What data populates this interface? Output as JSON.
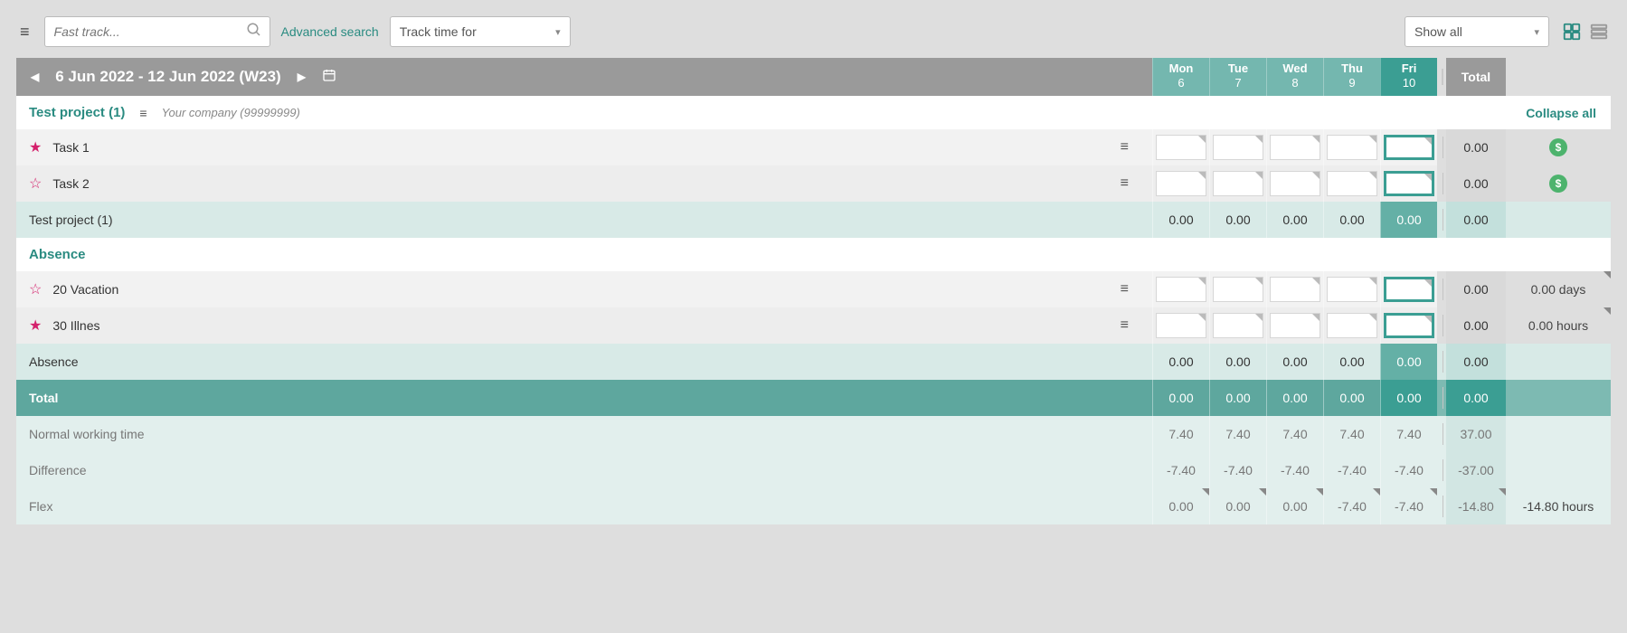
{
  "topbar": {
    "search_placeholder": "Fast track...",
    "advanced_search": "Advanced search",
    "track_time_for": "Track time for",
    "show_all": "Show all"
  },
  "header": {
    "date_range": "6 Jun 2022 - 12 Jun 2022 (W23)",
    "days": [
      {
        "name": "Mon",
        "num": "6"
      },
      {
        "name": "Tue",
        "num": "7"
      },
      {
        "name": "Wed",
        "num": "8"
      },
      {
        "name": "Thu",
        "num": "9"
      },
      {
        "name": "Fri",
        "num": "10"
      }
    ],
    "total": "Total"
  },
  "section1": {
    "title": "Test project (1)",
    "sub": "Your company (99999999)",
    "collapse": "Collapse all"
  },
  "rows": {
    "task1": {
      "label": "Task 1",
      "total": "0.00"
    },
    "task2": {
      "label": "Task 2",
      "total": "0.00"
    },
    "proj_sub": {
      "label": "Test project (1)",
      "v": [
        "0.00",
        "0.00",
        "0.00",
        "0.00",
        "0.00"
      ],
      "total": "0.00"
    }
  },
  "section2": {
    "title": "Absence"
  },
  "absence": {
    "vacation": {
      "label": "20 Vacation",
      "total": "0.00",
      "unit": "0.00 days"
    },
    "illness": {
      "label": "30 Illnes",
      "total": "0.00",
      "unit": "0.00 hours"
    },
    "sub": {
      "label": "Absence",
      "v": [
        "0.00",
        "0.00",
        "0.00",
        "0.00",
        "0.00"
      ],
      "total": "0.00"
    }
  },
  "total_row": {
    "label": "Total",
    "v": [
      "0.00",
      "0.00",
      "0.00",
      "0.00",
      "0.00"
    ],
    "total": "0.00"
  },
  "normal": {
    "label": "Normal working time",
    "v": [
      "7.40",
      "7.40",
      "7.40",
      "7.40",
      "7.40"
    ],
    "total": "37.00"
  },
  "diff": {
    "label": "Difference",
    "v": [
      "-7.40",
      "-7.40",
      "-7.40",
      "-7.40",
      "-7.40"
    ],
    "total": "-37.00"
  },
  "flex": {
    "label": "Flex",
    "v": [
      "0.00",
      "0.00",
      "0.00",
      "-7.40",
      "-7.40"
    ],
    "total": "-14.80",
    "unit": "-14.80 hours"
  }
}
